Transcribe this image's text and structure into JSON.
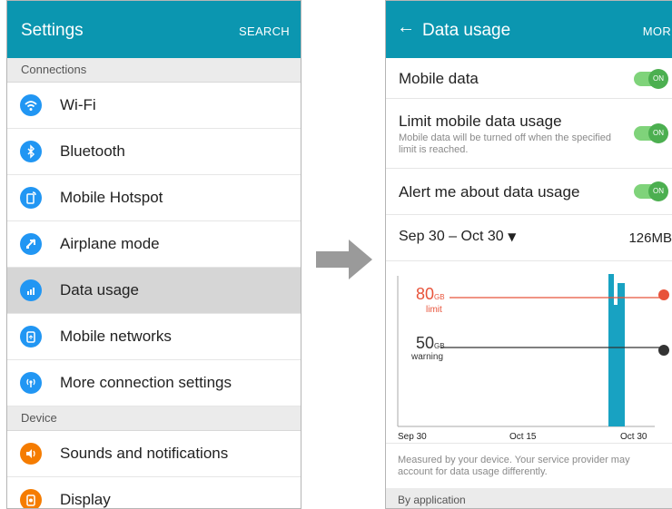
{
  "left": {
    "title": "Settings",
    "action": "SEARCH",
    "sections": [
      {
        "header": "Connections"
      },
      {
        "header": "Device"
      }
    ],
    "items": [
      {
        "label": "Wi-Fi",
        "icon": "wifi-icon",
        "color": "#2196f3"
      },
      {
        "label": "Bluetooth",
        "icon": "bluetooth-icon",
        "color": "#2196f3"
      },
      {
        "label": "Mobile Hotspot",
        "icon": "hotspot-icon",
        "color": "#2196f3"
      },
      {
        "label": "Airplane mode",
        "icon": "airplane-icon",
        "color": "#2196f3"
      },
      {
        "label": "Data usage",
        "icon": "data-usage-icon",
        "color": "#2196f3"
      },
      {
        "label": "Mobile networks",
        "icon": "mobile-networks-icon",
        "color": "#2196f3"
      },
      {
        "label": "More connection settings",
        "icon": "more-connection-icon",
        "color": "#2196f3"
      },
      {
        "label": "Sounds and notifications",
        "icon": "sound-icon",
        "color": "#f57c00"
      },
      {
        "label": "Display",
        "icon": "display-icon",
        "color": "#f57c00"
      }
    ]
  },
  "right": {
    "title": "Data usage",
    "action": "MORE",
    "mobile_data": "Mobile data",
    "limit_title": "Limit mobile data usage",
    "limit_sub": "Mobile data will be turned off when the specified limit is reached.",
    "alert_title": "Alert me about data usage",
    "toggle_on": "ON",
    "period": "Sep 30 – Oct 30",
    "period_caret": "▼",
    "usage_total": "126MB",
    "graph": {
      "limit_value": "80",
      "limit_unit": "GB",
      "limit_label": "limit",
      "warning_value": "50",
      "warning_unit": "GB",
      "warning_label": "warning",
      "x_labels": [
        "Sep 30",
        "Oct 15",
        "Oct 30"
      ],
      "limit_color": "#e8533a",
      "warning_color": "#333333",
      "bar_color": "#18a2c2"
    },
    "note": "Measured by your device. Your service provider may account for data usage differently.",
    "by_application": "By application"
  }
}
